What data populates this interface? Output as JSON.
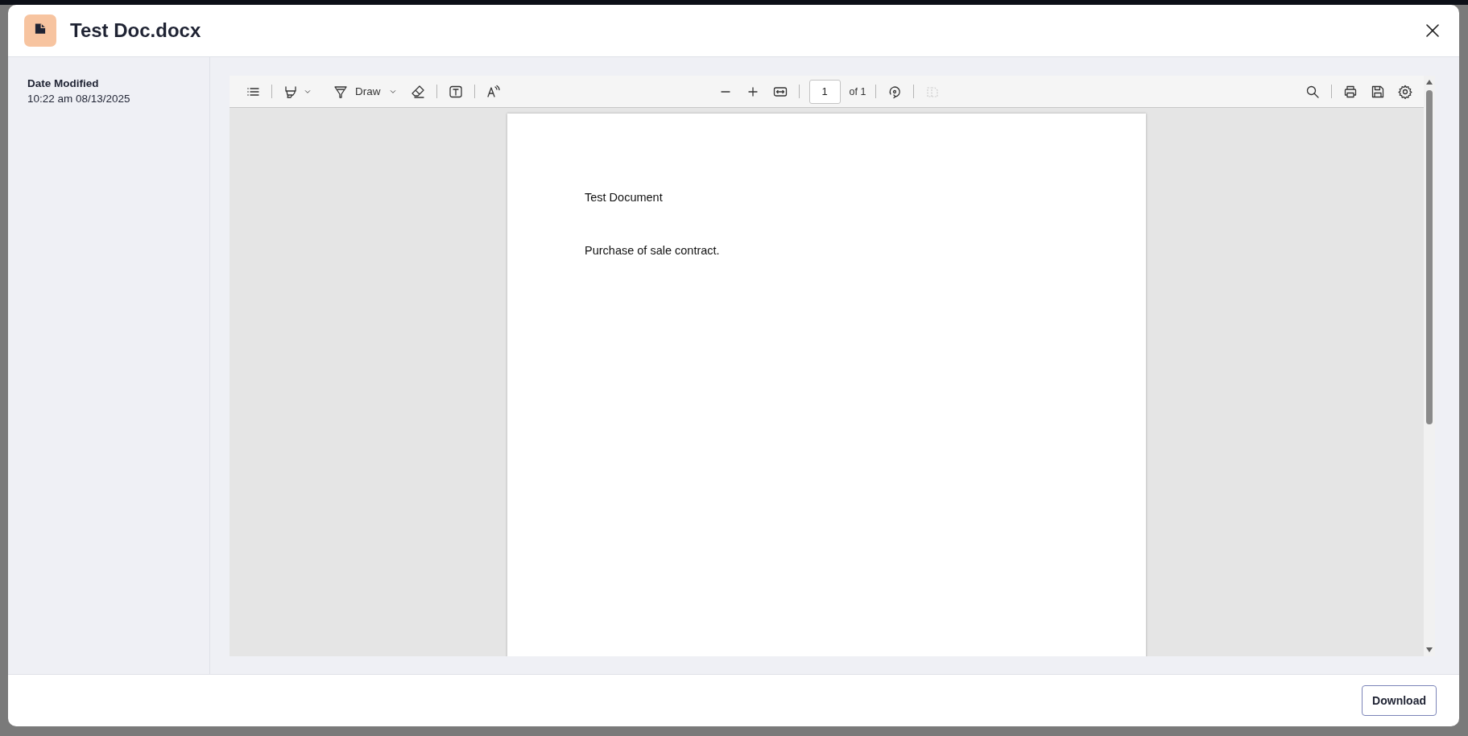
{
  "dialog": {
    "title": "Test Doc.docx"
  },
  "details": [
    {
      "label": "Date Modified",
      "value": "10:22 am 08/13/2025"
    }
  ],
  "toolbar": {
    "draw_label": "Draw",
    "page_field": {
      "value": "1"
    },
    "page_count": "of 1",
    "page_layout": {
      "disabled": true
    }
  },
  "document": {
    "paragraphs": [
      "Test Document",
      "Purchase of sale contract."
    ]
  },
  "footer": {
    "buttons": [
      "Download"
    ]
  }
}
